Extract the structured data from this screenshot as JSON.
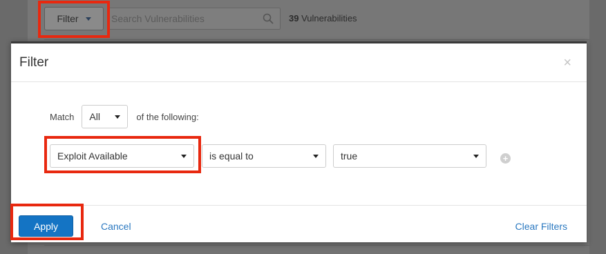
{
  "toolbar": {
    "filter_label": "Filter",
    "search_placeholder": "Search Vulnerabilities",
    "count_number": "39",
    "count_label": "Vulnerabilities"
  },
  "modal": {
    "title": "Filter",
    "close_glyph": "×",
    "match_label": "Match",
    "match_value": "All",
    "match_suffix": "of the following:",
    "condition": {
      "field": "Exploit Available",
      "operator": "is equal to",
      "value": "true"
    },
    "add_glyph": "+",
    "apply_label": "Apply",
    "cancel_label": "Cancel",
    "clear_label": "Clear Filters"
  },
  "colors": {
    "highlight": "#e8280f",
    "primary": "#1474c4",
    "link": "#2a78c0"
  },
  "icons": [
    "chevron-down-icon",
    "search-icon",
    "close-icon",
    "add-circle-icon"
  ]
}
